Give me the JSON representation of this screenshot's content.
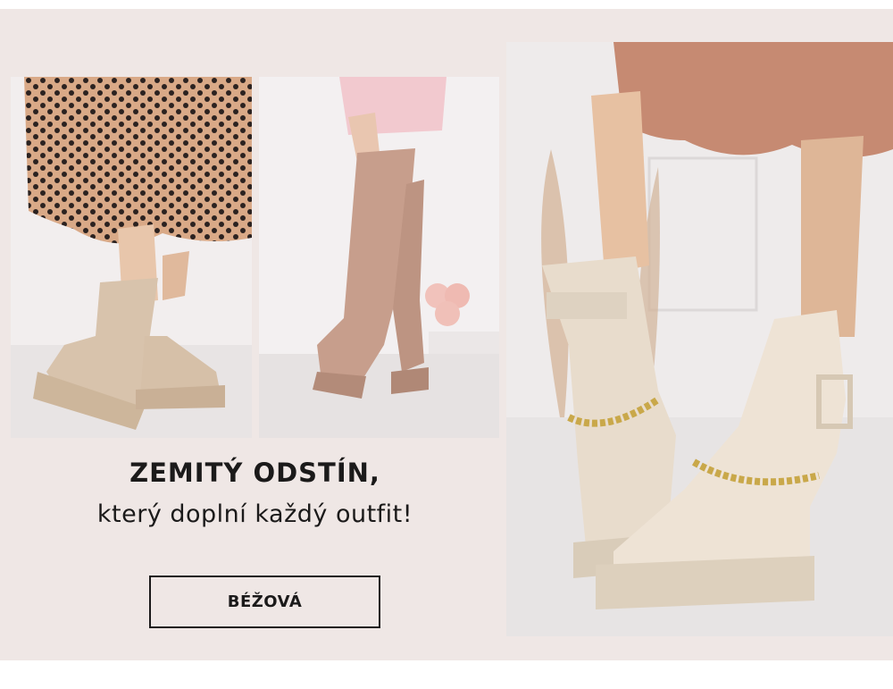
{
  "banner": {
    "title": "ZEMITÝ ODSTÍN,",
    "subtitle": "který doplní každý outfit!",
    "cta_label": "BÉŽOVÁ"
  },
  "colors": {
    "background": "#efe7e5",
    "text": "#1b1a1a",
    "beige_boot": "#e9dccd",
    "suede_boot": "#c79e8c",
    "sock_boot": "#d8c3ac",
    "dotted_skirt": "#d8a98a",
    "knit_skirt": "#c68a72"
  },
  "images": [
    {
      "name": "beige sock boots with polka dot skirt"
    },
    {
      "name": "tan over-the-knee suede boots"
    },
    {
      "name": "cream combat boots with gold chain"
    }
  ]
}
